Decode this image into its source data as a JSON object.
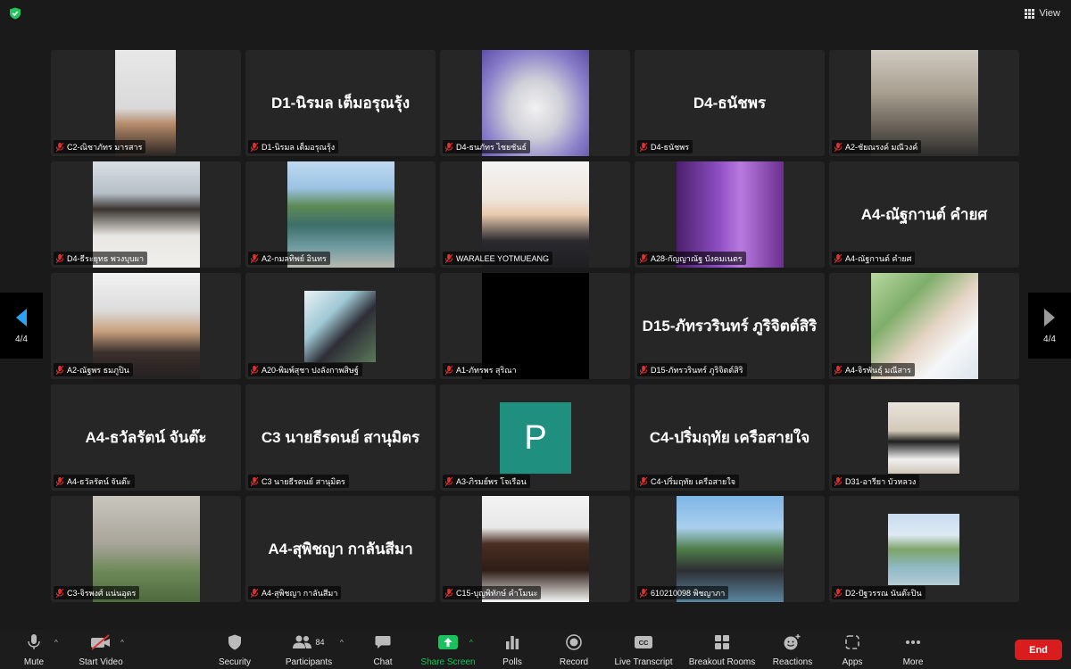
{
  "top": {
    "view_label": "View"
  },
  "pager": {
    "left_label": "4/4",
    "right_label": "4/4"
  },
  "tiles": [
    {
      "label": "C2-ณิชาภัทร มารสาร",
      "big": ""
    },
    {
      "label": "D1-นิรมล เต็มอรุณรุ้ง",
      "big": "D1-นิรมล เต็มอรุณรุ้ง"
    },
    {
      "label": "D4-ธนภัทร ไชยชันธ์",
      "big": ""
    },
    {
      "label": "D4-ธนัชพร",
      "big": "D4-ธนัชพร"
    },
    {
      "label": "A2-ชัยณรงค์ มณีวงค์",
      "big": ""
    },
    {
      "label": "D4-ธีระยุทธ พวงบุบผา",
      "big": ""
    },
    {
      "label": "A2-กมลทิพย์ อินทร",
      "big": ""
    },
    {
      "label": "WARALEE YOTMUEANG",
      "big": ""
    },
    {
      "label": "A28-กัญญาณัฐ บังคมเนตร",
      "big": ""
    },
    {
      "label": "A4-ณัฐกานต์ คำยศ",
      "big": "A4-ณัฐกานต์ คำยศ"
    },
    {
      "label": "A2-ณัฐพร ธมภูปิน",
      "big": ""
    },
    {
      "label": "A20-พิมพ์สุชา ปงลังกาพสิษฐ์",
      "big": ""
    },
    {
      "label": "A1-ภัทรพร สุริณา",
      "big": ""
    },
    {
      "label": "D15-ภัทรวรินทร์ ภูริจิตต์สิริ",
      "big": "D15-ภัทรวรินทร์ ภูริจิตต์สิริ"
    },
    {
      "label": "A4-จิรพันธุ์ มณีสาร",
      "big": ""
    },
    {
      "label": "A4-ธวัลรัตน์ จันต๊ะ",
      "big": "A4-ธวัลรัตน์ จันต๊ะ"
    },
    {
      "label": "C3 นายธีรดนย์ สานุมิตร",
      "big": "C3 นายธีรดนย์ สานุมิตร"
    },
    {
      "label": "A3-ภิรมย์พร โจเรือน",
      "big": "",
      "initial": "P"
    },
    {
      "label": "C4-ปริ่มฤทัย เครือสายใจ",
      "big": "C4-ปริ่มฤทัย เครือสายใจ"
    },
    {
      "label": "D31-อารียา บัวหลวง",
      "big": ""
    },
    {
      "label": "C3-จิรพงศ์ แน่นอุดร",
      "big": ""
    },
    {
      "label": "A4-สุพิชญา กาลันสีมา",
      "big": "A4-สุพิชญา กาลันสีมา"
    },
    {
      "label": "C15-บุญพิทักษ์ คำโมนะ",
      "big": ""
    },
    {
      "label": "610210098 พิชญาภา",
      "big": ""
    },
    {
      "label": "D2-ปัฐวรรณ นันต๊ะปิน",
      "big": ""
    }
  ],
  "toolbar": {
    "mute": "Mute",
    "start_video": "Start Video",
    "security": "Security",
    "participants": "Participants",
    "participants_count": "84",
    "chat": "Chat",
    "share_screen": "Share Screen",
    "polls": "Polls",
    "record": "Record",
    "live_transcript": "Live Transcript",
    "breakout_rooms": "Breakout Rooms",
    "reactions": "Reactions",
    "apps": "Apps",
    "more": "More",
    "end": "End"
  },
  "colors": {
    "share_green": "#19c15f",
    "end_red": "#d91c1c",
    "accent_blue": "#1f8ff0"
  }
}
